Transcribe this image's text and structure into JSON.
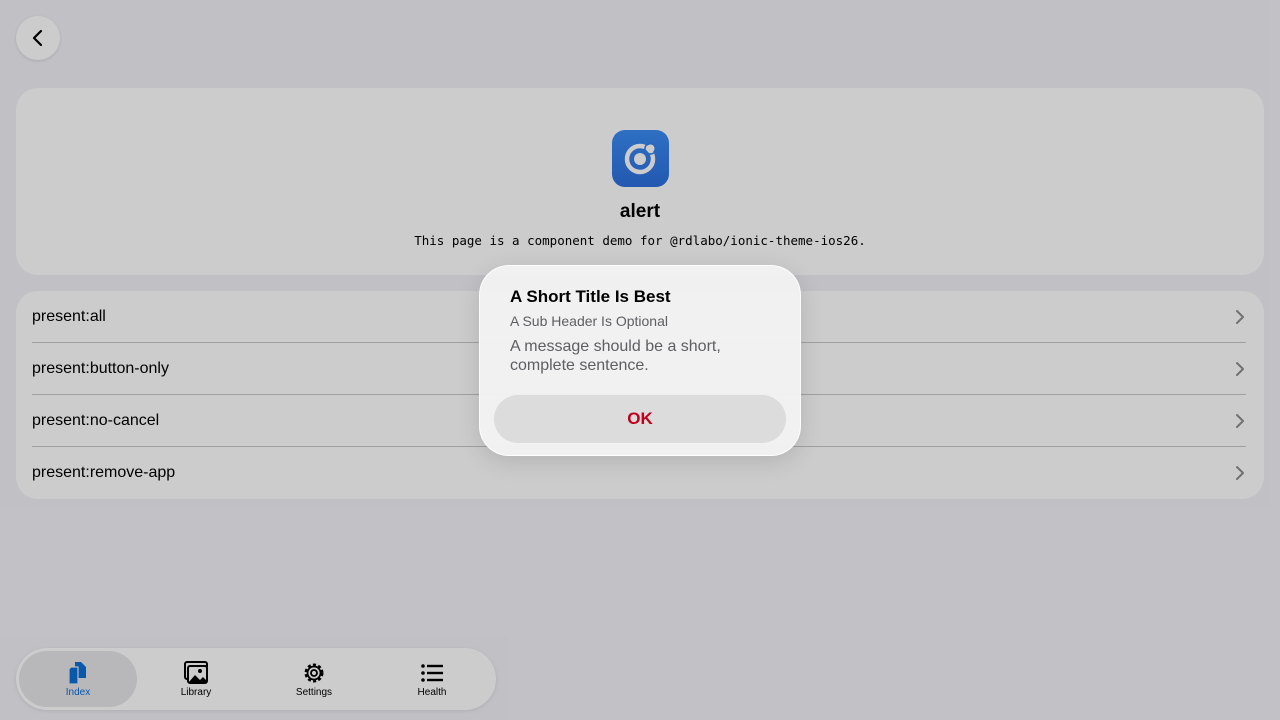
{
  "page": {
    "title": "alert",
    "description": "This page is a component demo for @rdlabo/ionic-theme-ios26."
  },
  "list": {
    "items": [
      {
        "label": "present:all"
      },
      {
        "label": "present:button-only"
      },
      {
        "label": "present:no-cancel"
      },
      {
        "label": "present:remove-app"
      }
    ]
  },
  "tabs": [
    {
      "label": "Index",
      "icon": "documents-icon",
      "active": true
    },
    {
      "label": "Library",
      "icon": "images-icon",
      "active": false
    },
    {
      "label": "Settings",
      "icon": "gear-icon",
      "active": false
    },
    {
      "label": "Health",
      "icon": "list-icon",
      "active": false
    }
  ],
  "alert": {
    "title": "A Short Title Is Best",
    "subtitle": "A Sub Header Is Optional",
    "message": "A message should be a short, complete sentence.",
    "button": "OK"
  },
  "colors": {
    "accent": "#0a6ed8",
    "alert_button": "#c0001c",
    "app_icon": "#2c6fde"
  }
}
